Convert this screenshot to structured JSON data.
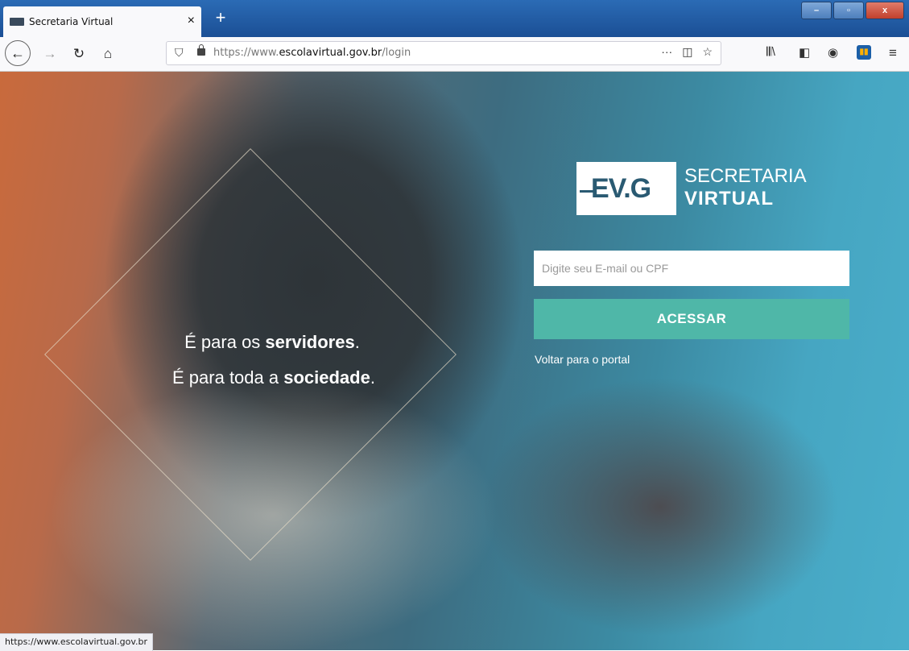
{
  "browser": {
    "tab_title": "Secretaria Virtual",
    "tab_close": "×",
    "new_tab": "+",
    "url_domain_prefix": "https://www.",
    "url_domain": "escolavirtual.gov.br",
    "url_path": "/login",
    "window_buttons": {
      "minimize": "–",
      "maximize": "▫",
      "close": "x"
    },
    "status_text": "https://www.escolavirtual.gov.br"
  },
  "page": {
    "tagline_line1_prefix": "É para os ",
    "tagline_line1_bold": "servidores",
    "tagline_line1_suffix": ".",
    "tagline_line2_prefix": "É para toda a ",
    "tagline_line2_bold": "sociedade",
    "tagline_line2_suffix": ".",
    "logo_mark": "EV.G",
    "logo_title": "SECRETARIA",
    "logo_subtitle": "VIRTUAL",
    "login_placeholder": "Digite seu E-mail ou CPF",
    "login_value": "",
    "submit_label": "ACESSAR",
    "back_link": "Voltar para o portal"
  },
  "colors": {
    "accent_button": "#4fb7a8",
    "titlebar": "#1b4f95"
  }
}
